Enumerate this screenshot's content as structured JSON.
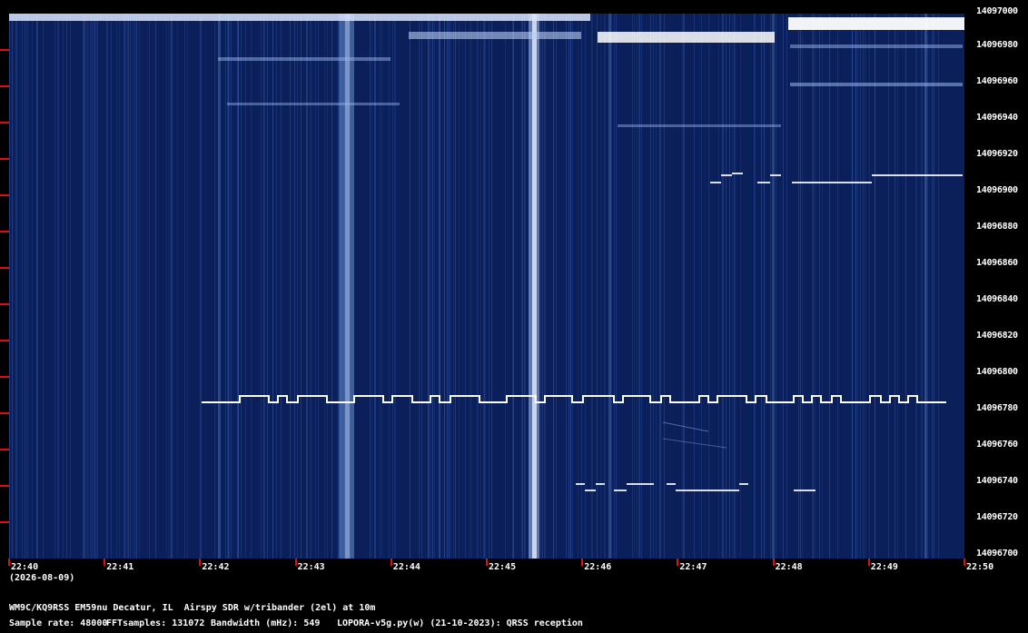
{
  "frequency_axis": {
    "labels": [
      "14097000",
      "14096980",
      "14096960",
      "14096940",
      "14096920",
      "14096900",
      "14096880",
      "14096860",
      "14096840",
      "14096820",
      "14096800",
      "14096780",
      "14096760",
      "14096740",
      "14096720",
      "14096700"
    ]
  },
  "time_axis": {
    "labels": [
      "22:40",
      "22:41",
      "22:42",
      "22:43",
      "22:44",
      "22:45",
      "22:46",
      "22:47",
      "22:48",
      "22:49",
      "22:50"
    ],
    "date": "(2026-08-09)"
  },
  "station": {
    "description": "WM9C/KQ9RSS EM59nu Decatur, IL  Airspy SDR w/tribander (2el) at 10m"
  },
  "params": {
    "sample_rate": "Sample rate: 48000",
    "fft_samples": "FFTsamples: 131072",
    "bandwidth": "Bandwidth (mHz): 549",
    "software": "LOPORA-v5g.py(w) (21-10-2023): QRSS reception"
  },
  "colors": {
    "background": "#0b1f5a",
    "signal": "#ffffff",
    "tick": "#e01010"
  }
}
